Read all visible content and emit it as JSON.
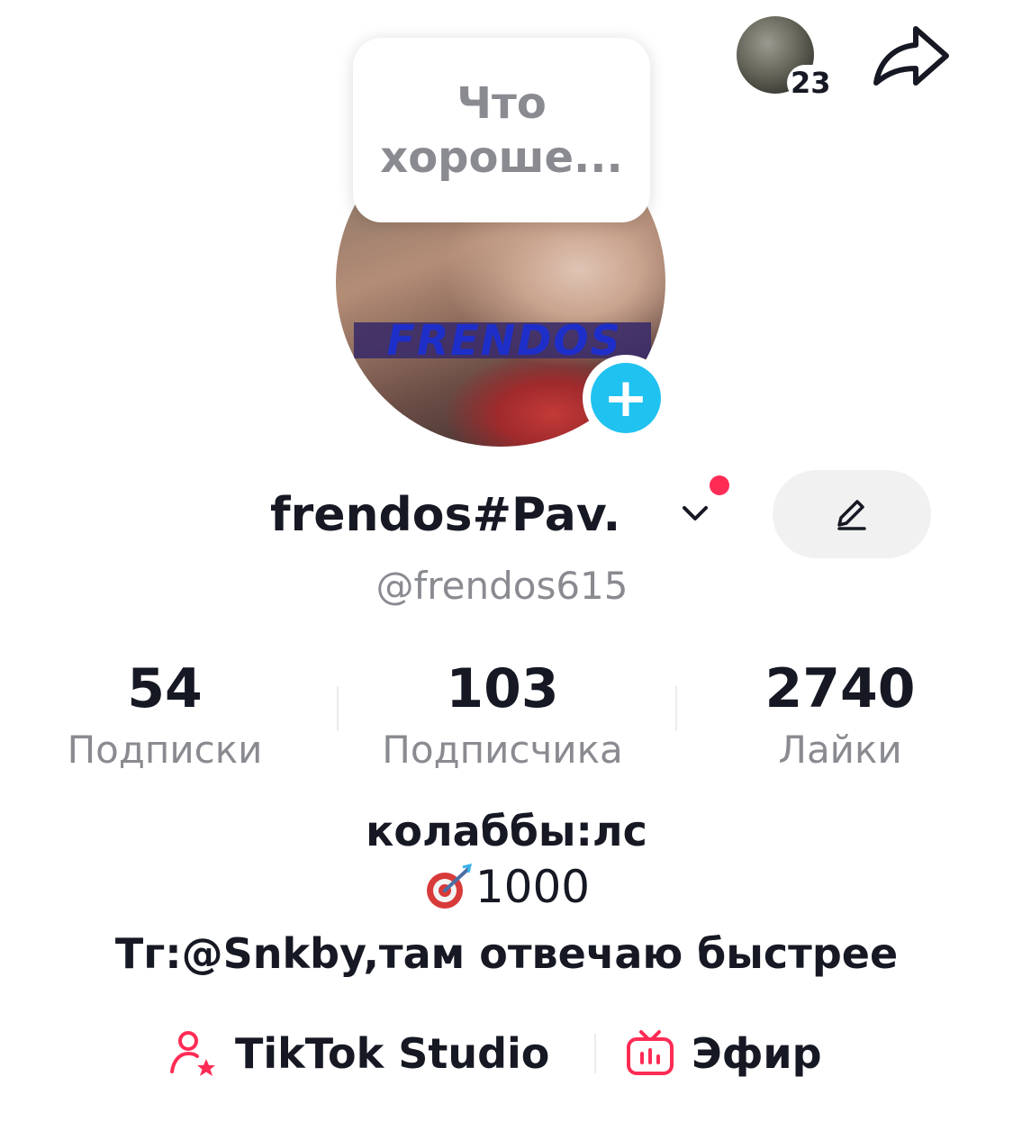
{
  "colors": {
    "primary_text": "#161823",
    "secondary_text": "#8a8b91",
    "accent_blue": "#20c2f0",
    "accent_red": "#fe2c55",
    "chip_bg": "#f1f1f2"
  },
  "header": {
    "profile_visitors_count": "23",
    "share_icon": "share-arrow-icon"
  },
  "note": {
    "text": "Что\nхороше..."
  },
  "avatar": {
    "logo_text": "FRENDOS",
    "add_icon": "plus-icon"
  },
  "profile": {
    "display_name": "frendos#Pav.",
    "username": "@frendos615",
    "edit_icon": "pencil-icon"
  },
  "stats": [
    {
      "value": "54",
      "label": "Подписки"
    },
    {
      "value": "103",
      "label": "Подписчика"
    },
    {
      "value": "2740",
      "label": "Лайки"
    }
  ],
  "bio": {
    "line1": "колаббы:лс",
    "line2_emoji": "target-arrow-icon",
    "line2": "1000",
    "line3": "Tг:@Snkby,там отвечаю быстрее"
  },
  "links": {
    "studio": {
      "label": "TikTok Studio",
      "icon": "person-star-icon"
    },
    "live": {
      "label": "Эфир",
      "icon": "tv-live-icon"
    }
  }
}
